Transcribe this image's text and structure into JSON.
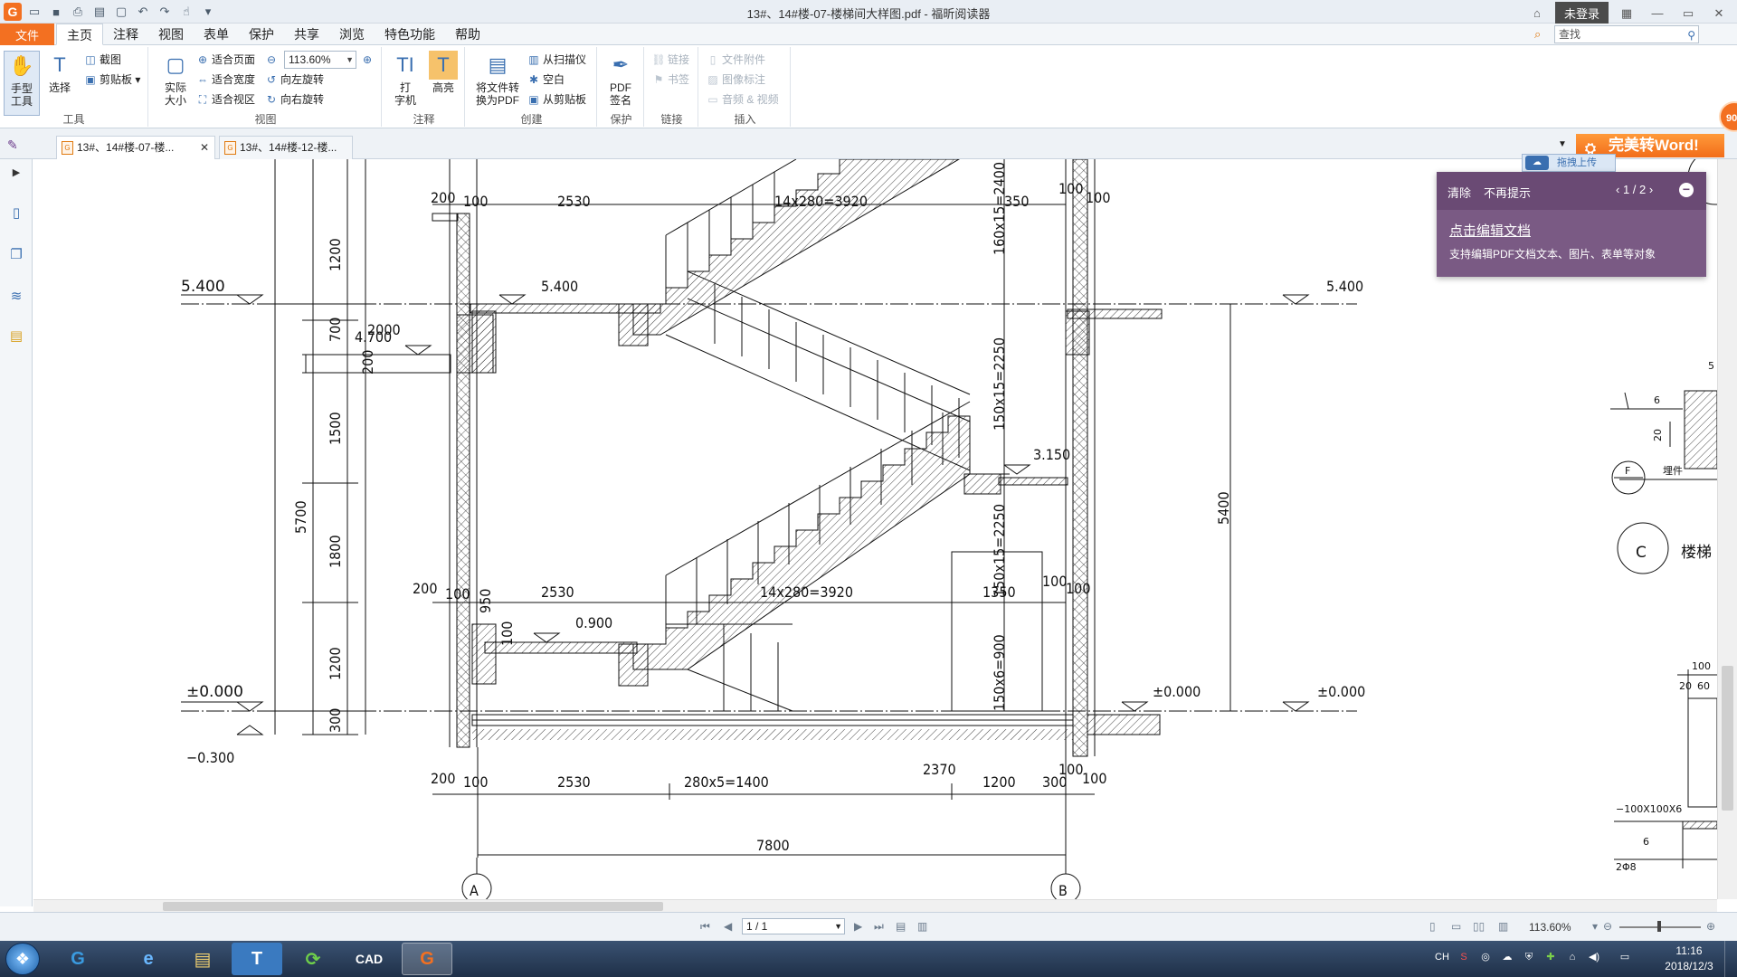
{
  "titlebar": {
    "title": "13#、14#楼-07-楼梯间大样图.pdf - 福昕阅读器",
    "login": "未登录"
  },
  "menu": {
    "file": "文件",
    "tabs": [
      "主页",
      "注释",
      "视图",
      "表单",
      "保护",
      "共享",
      "浏览",
      "特色功能",
      "帮助"
    ],
    "search_placeholder": "查找"
  },
  "ribbon": {
    "groups": {
      "tools": "工具",
      "view": "视图",
      "annotate": "注释",
      "create": "创建",
      "protect": "保护",
      "links": "链接",
      "insert": "插入"
    },
    "hand_tool": "手型\n工具",
    "select": "选择",
    "screenshot": "截图",
    "clipboard": "剪贴板",
    "actual_size": "实际\n大小",
    "fit_page": "适合页面",
    "fit_width": "适合宽度",
    "fit_visible": "适合视区",
    "zoom": "113.60%",
    "rotate_left": "向左旋转",
    "rotate_right": "向右旋转",
    "typewriter": "打\n字机",
    "highlight": "高亮",
    "convert_to_pdf": "将文件转\n换为PDF",
    "from_scanner": "从扫描仪",
    "blank": "空白",
    "from_clipboard": "从剪贴板",
    "pdf_sign": "PDF\n签名",
    "link": "链接",
    "bookmark": "书签",
    "file_attachment": "文件附件",
    "image_annotation": "图像标注",
    "audio_video": "音频 & 视频"
  },
  "doctabs": [
    {
      "label": "13#、14#楼-07-楼..."
    },
    {
      "label": "13#、14#楼-12-楼..."
    }
  ],
  "promo": {
    "convert_word": "完美转Word!",
    "badge": "90",
    "upload": "拖拽上传"
  },
  "popup": {
    "clear": "清除",
    "no_hint": "不再提示",
    "pager": "1 / 2",
    "link": "点击编辑文档",
    "desc": "支持编辑PDF文档文本、图片、表单等对象"
  },
  "drawing": {
    "labels": {
      "elev_5400": "5.400",
      "elev_4700": "4.700",
      "elev_3150": "3.150",
      "elev_0900": "0.900",
      "elev_000": "±0.000",
      "elev_m0300": "−0.300",
      "d200a": "200",
      "d100a": "100",
      "d2530a": "2530",
      "d14x280a": "14x280=3920",
      "d350": "350",
      "d100b": "100",
      "d100c": "100",
      "d160x15": "160x15=2400",
      "d150x15a": "150x15=2250",
      "d150x15b": "150x15=2250",
      "d150x6": "150x6=900",
      "d2000": "2000",
      "d200b": "200",
      "d1200a": "1200",
      "d700": "700",
      "d1500": "1500",
      "d5700": "5700",
      "d1800": "1800",
      "d1200b": "1200",
      "d300a": "300",
      "d200c": "200",
      "d100d": "100",
      "d950": "950",
      "d100e": "100",
      "d2530b": "2530",
      "d14x280b": "14x280=3920",
      "d1350": "1350",
      "d100f": "100",
      "d100g": "100",
      "d200d": "200",
      "d100h": "100",
      "d2530c": "2530",
      "d280x5": "280x5=1400",
      "d2370": "2370",
      "d1200c": "1200",
      "d300b": "300",
      "d100i": "100",
      "d100j": "100",
      "d7800": "7800",
      "d5400": "5400",
      "axisA": "A",
      "axisB": "B",
      "axisC": "C",
      "axisF": "F",
      "stair": "楼梯",
      "embed": "埋件",
      "d6a": "6",
      "d20": "20",
      "d100k": "100",
      "d20b": "20",
      "d60": "60",
      "plate": "−100X100X6",
      "d6b": "6",
      "d2phi8": "2Φ8",
      "d5": "5"
    }
  },
  "statusbar": {
    "page": "1 / 1",
    "zoom": "113.60%"
  },
  "taskbar": {
    "time": "11:16",
    "date": "2018/12/3",
    "lang": "CH"
  }
}
